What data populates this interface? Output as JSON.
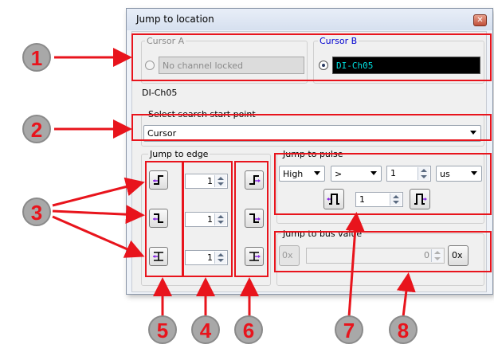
{
  "window": {
    "title": "Jump to location",
    "close_glyph": "✕"
  },
  "cursors": {
    "cursor_a": {
      "label": "Cursor A",
      "value": "No channel locked"
    },
    "cursor_b": {
      "label": "Cursor B",
      "value": "DI-Ch05"
    }
  },
  "channel_label": "DI-Ch05",
  "search_start": {
    "group_label": "Select search start point",
    "selected": "Cursor"
  },
  "jump_to_edge": {
    "group_label": "Jump to edge",
    "rows": [
      {
        "count": "1"
      },
      {
        "count": "1"
      },
      {
        "count": "1"
      }
    ]
  },
  "jump_to_pulse": {
    "group_label": "Jump to pulse",
    "polarity": "High",
    "comparator": ">",
    "width_value": "1",
    "unit": "us",
    "count": "1"
  },
  "jump_to_bus": {
    "group_label": "Jump to bus value",
    "value": "0",
    "prev_label": "0x",
    "next_label": "0x"
  },
  "callouts": [
    "1",
    "2",
    "3",
    "4",
    "5",
    "6",
    "7",
    "8"
  ],
  "colors": {
    "annotation_red": "#e8141c",
    "cursor_b_blue": "#0000d0",
    "channel_text_cyan": "#00e0e0"
  }
}
